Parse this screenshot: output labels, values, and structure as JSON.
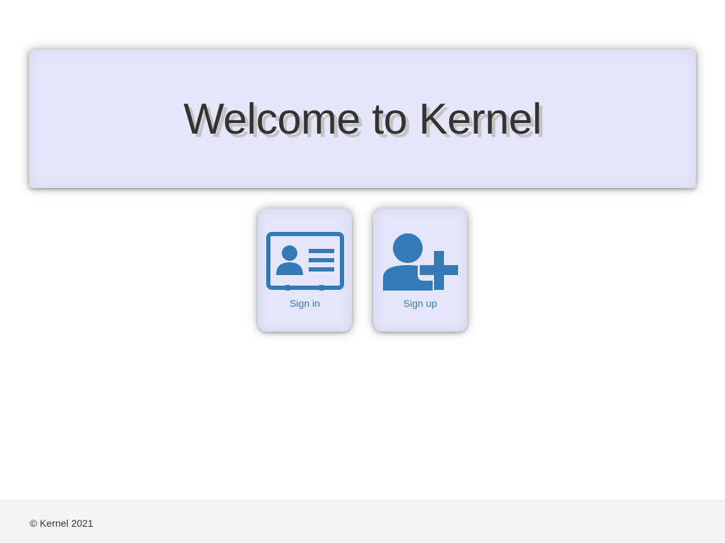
{
  "hero": {
    "title": "Welcome to Kernel"
  },
  "actions": [
    {
      "label": "Sign in",
      "icon": "id-card-icon"
    },
    {
      "label": "Sign up",
      "icon": "user-plus-icon"
    }
  ],
  "footer": {
    "copyright": "© Kernel 2021"
  },
  "colors": {
    "panel": "#e6e6fa",
    "accent": "#337ab7",
    "title": "#333333",
    "footer_bg": "#f4f4f4"
  }
}
